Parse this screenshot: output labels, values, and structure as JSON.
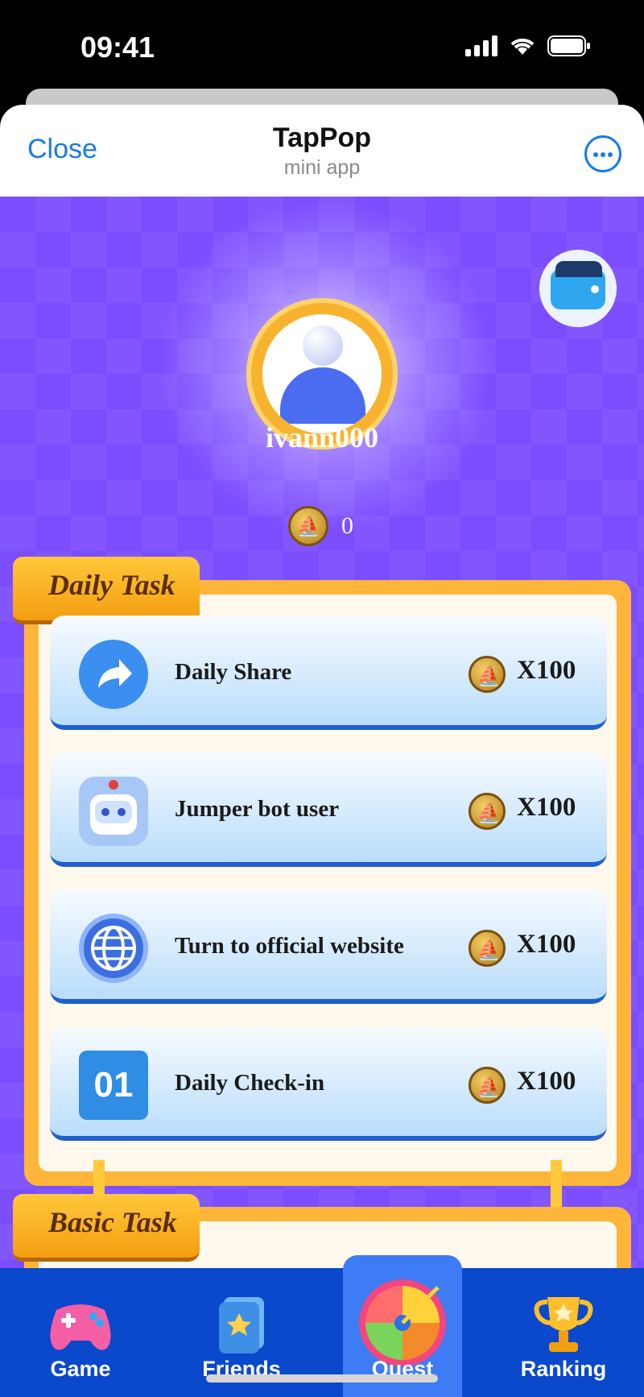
{
  "status_bar": {
    "time": "09:41"
  },
  "header": {
    "close_label": "Close",
    "title": "TapPop",
    "subtitle": "mini app"
  },
  "profile": {
    "username": "ivann000",
    "balance": "0"
  },
  "daily_task": {
    "title": "Daily Task",
    "tasks": [
      {
        "label": "Daily Share",
        "reward": "X100",
        "icon": "share-icon"
      },
      {
        "label": "Jumper bot user",
        "reward": "X100",
        "icon": "robot-icon"
      },
      {
        "label": "Turn to official website",
        "reward": "X100",
        "icon": "globe-icon"
      },
      {
        "label": "Daily Check-in",
        "reward": "X100",
        "icon": "calendar-icon",
        "icon_text": "01"
      }
    ]
  },
  "basic_task": {
    "title": "Basic Task"
  },
  "nav": {
    "items": [
      {
        "label": "Game",
        "icon": "gamepad-icon"
      },
      {
        "label": "Friends",
        "icon": "book-icon"
      },
      {
        "label": "Quest",
        "icon": "spin-wheel-icon",
        "active": true
      },
      {
        "label": "Ranking",
        "icon": "trophy-icon"
      }
    ]
  },
  "colors": {
    "background": "#7b4dff",
    "accent_gold": "#fdb53a",
    "nav_blue": "#0a48cc",
    "link_blue": "#1a7be6"
  }
}
